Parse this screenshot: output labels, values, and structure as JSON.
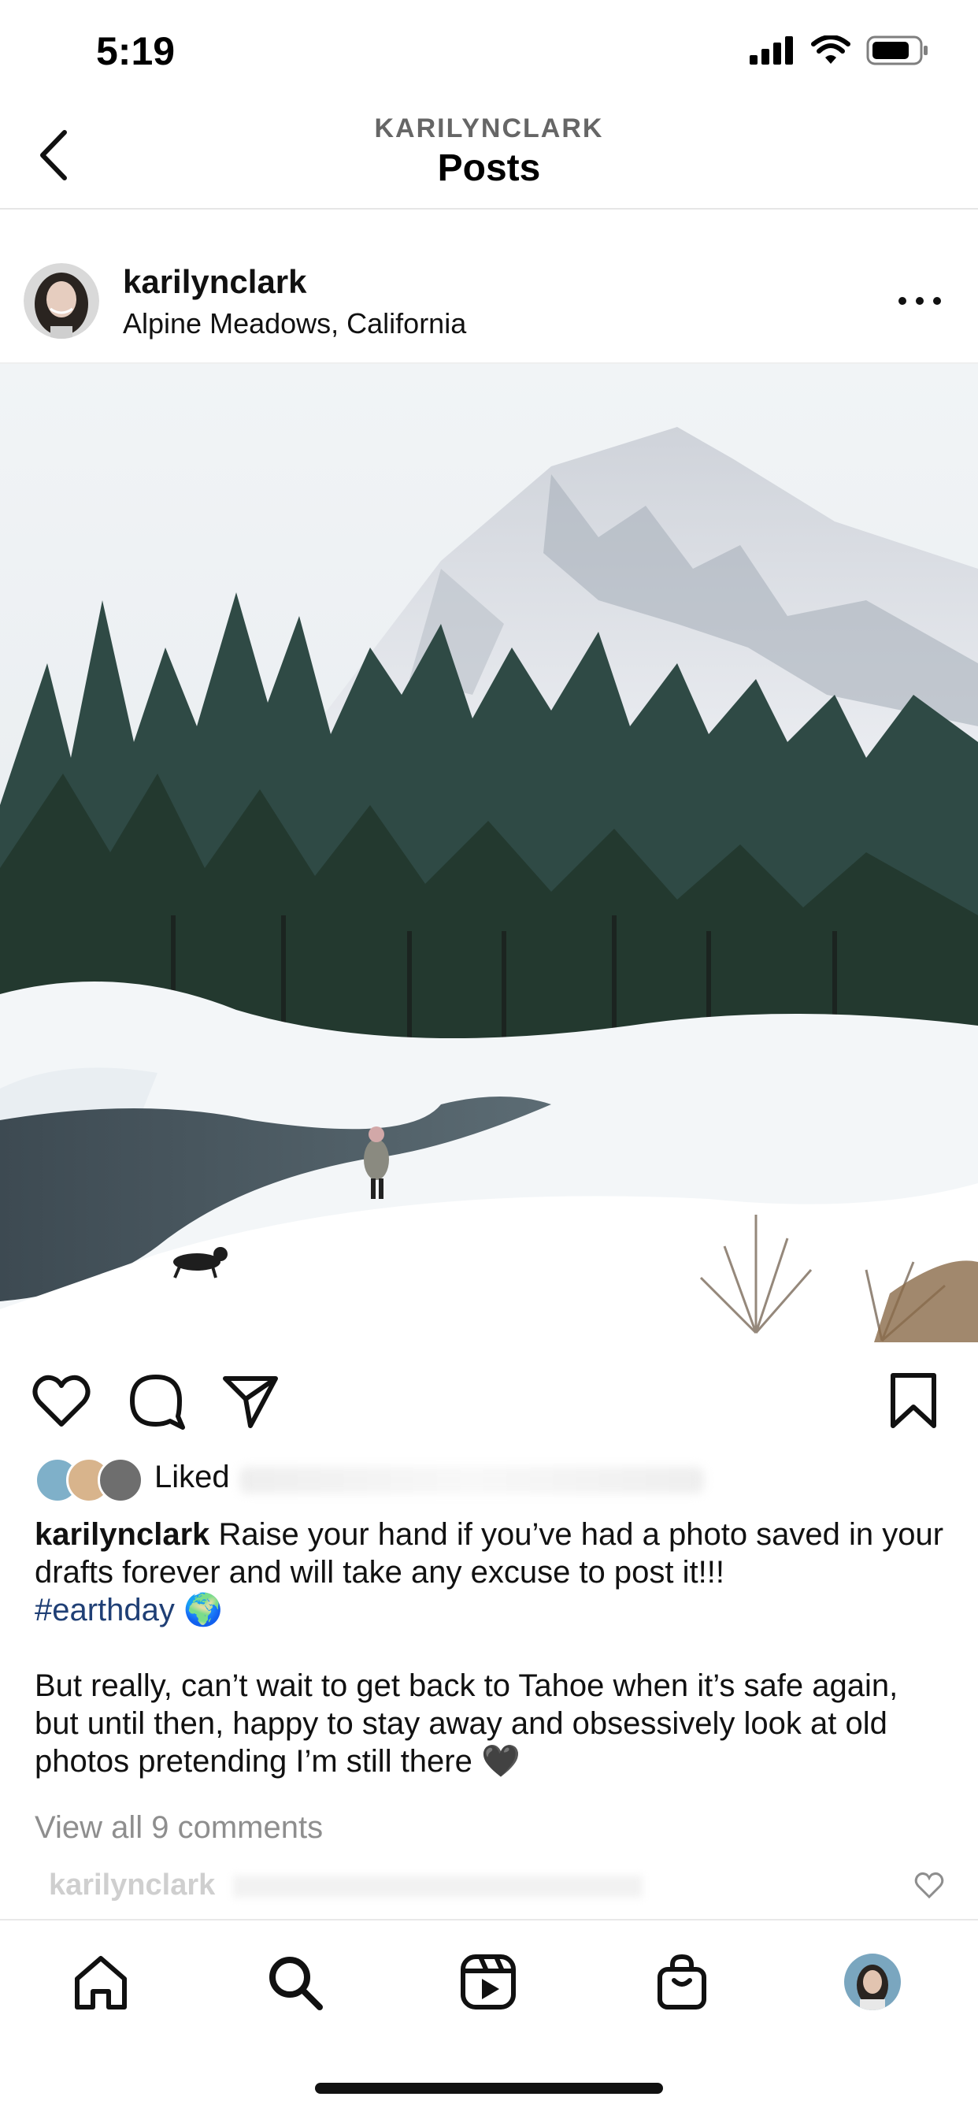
{
  "status_bar": {
    "time": "5:19"
  },
  "nav": {
    "subtitle": "KARILYNCLARK",
    "title": "Posts"
  },
  "post": {
    "username": "karilynclark",
    "location": "Alpine Meadows, California",
    "liked_prefix": "Liked",
    "caption_user": "karilynclark",
    "caption_line1": " Raise your hand if you’ve had a photo saved in your drafts forever and will take any excuse to post it!!!",
    "hashtag": "#earthday",
    "hashtag_emoji": "🌍",
    "caption_para2": "But really, can’t wait to get back to Tahoe when it’s safe again, but until then, happy to stay away and obsessively look at old photos pretending I’m still there",
    "caption_emoji2": "🖤",
    "view_comments": "View all 9 comments",
    "comment_peek_user": "karilynclark"
  },
  "icons": {
    "back": "chevron-left-icon",
    "more": "more-horizontal-icon",
    "like": "heart-icon",
    "comment": "comment-icon",
    "share": "paper-plane-icon",
    "save": "bookmark-icon",
    "tabs": [
      "home-icon",
      "search-icon",
      "reels-icon",
      "shop-icon",
      "profile-avatar"
    ]
  },
  "colors": {
    "hashtag": "#1f3f75",
    "muted": "#8e8e8e",
    "text": "#111111"
  }
}
